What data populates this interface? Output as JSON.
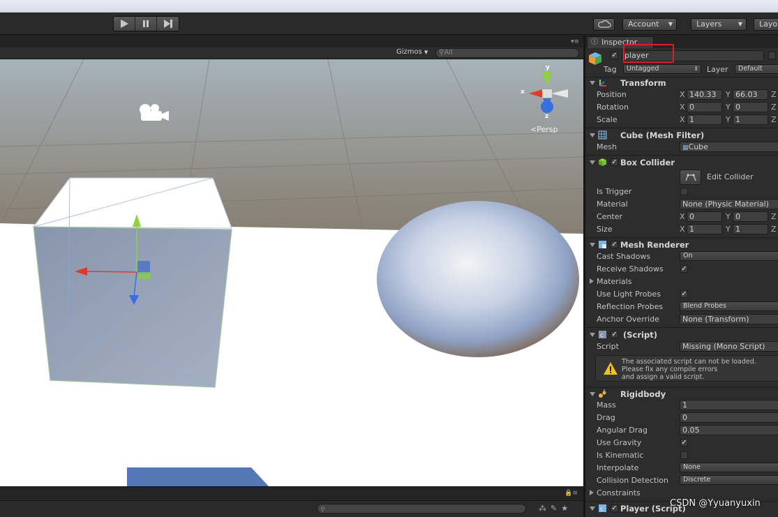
{
  "toolbar": {
    "account": "Account",
    "layers": "Layers",
    "layout": "Layo"
  },
  "scene": {
    "gizmos": "Gizmos",
    "search_placeholder": "All",
    "persp": "Persp",
    "axis_x": "x",
    "axis_y": "y",
    "axis_z": "z"
  },
  "inspector": {
    "tab": "Inspector",
    "name": "player",
    "tag_label": "Tag",
    "tag_value": "Untagged",
    "layer_label": "Layer",
    "layer_value": "Default",
    "transform": {
      "title": "Transform",
      "position": "Position",
      "rotation": "Rotation",
      "scale": "Scale",
      "pos": [
        "140.33",
        "66.03"
      ],
      "rot": [
        "0",
        "0"
      ],
      "scl": [
        "1",
        "1"
      ]
    },
    "mesh_filter": {
      "title": "Cube (Mesh Filter)",
      "mesh_label": "Mesh",
      "mesh_value": "Cube"
    },
    "box_collider": {
      "title": "Box Collider",
      "edit": "Edit Collider",
      "is_trigger": "Is Trigger",
      "material": "Material",
      "material_value": "None (Physic Material)",
      "center": "Center",
      "size": "Size",
      "center_vals": [
        "0",
        "0"
      ],
      "size_vals": [
        "1",
        "1"
      ]
    },
    "mesh_renderer": {
      "title": "Mesh Renderer",
      "cast_shadows": "Cast Shadows",
      "cast_value": "On",
      "receive_shadows": "Receive Shadows",
      "materials": "Materials",
      "light_probes": "Use Light Probes",
      "reflection_probes": "Reflection Probes",
      "reflection_value": "Blend Probes",
      "anchor_override": "Anchor Override",
      "anchor_value": "None (Transform)"
    },
    "script": {
      "title": "(Script)",
      "script_label": "Script",
      "script_value": "Missing (Mono Script)",
      "warning1": "The associated script can not be loaded.",
      "warning2": "Please fix any compile errors",
      "warning3": "and assign a valid script."
    },
    "rigidbody": {
      "title": "Rigidbody",
      "mass": "Mass",
      "mass_value": "1",
      "drag": "Drag",
      "drag_value": "0",
      "angular_drag": "Angular Drag",
      "angular_value": "0.05",
      "use_gravity": "Use Gravity",
      "is_kinematic": "Is Kinematic",
      "interpolate": "Interpolate",
      "interpolate_value": "None",
      "collision_detection": "Collision Detection",
      "collision_value": "Discrete",
      "constraints": "Constraints"
    },
    "player_script": {
      "title": "Player (Script)"
    },
    "axes": {
      "x": "X",
      "y": "Y",
      "z": "Z"
    }
  },
  "watermark": "CSDN @Yyuanyuxin",
  "colors": {
    "highlight_box": "#e02020",
    "x_axis": "#e03a2a",
    "y_axis": "#8fd23c",
    "z_axis": "#3a6fe0"
  }
}
